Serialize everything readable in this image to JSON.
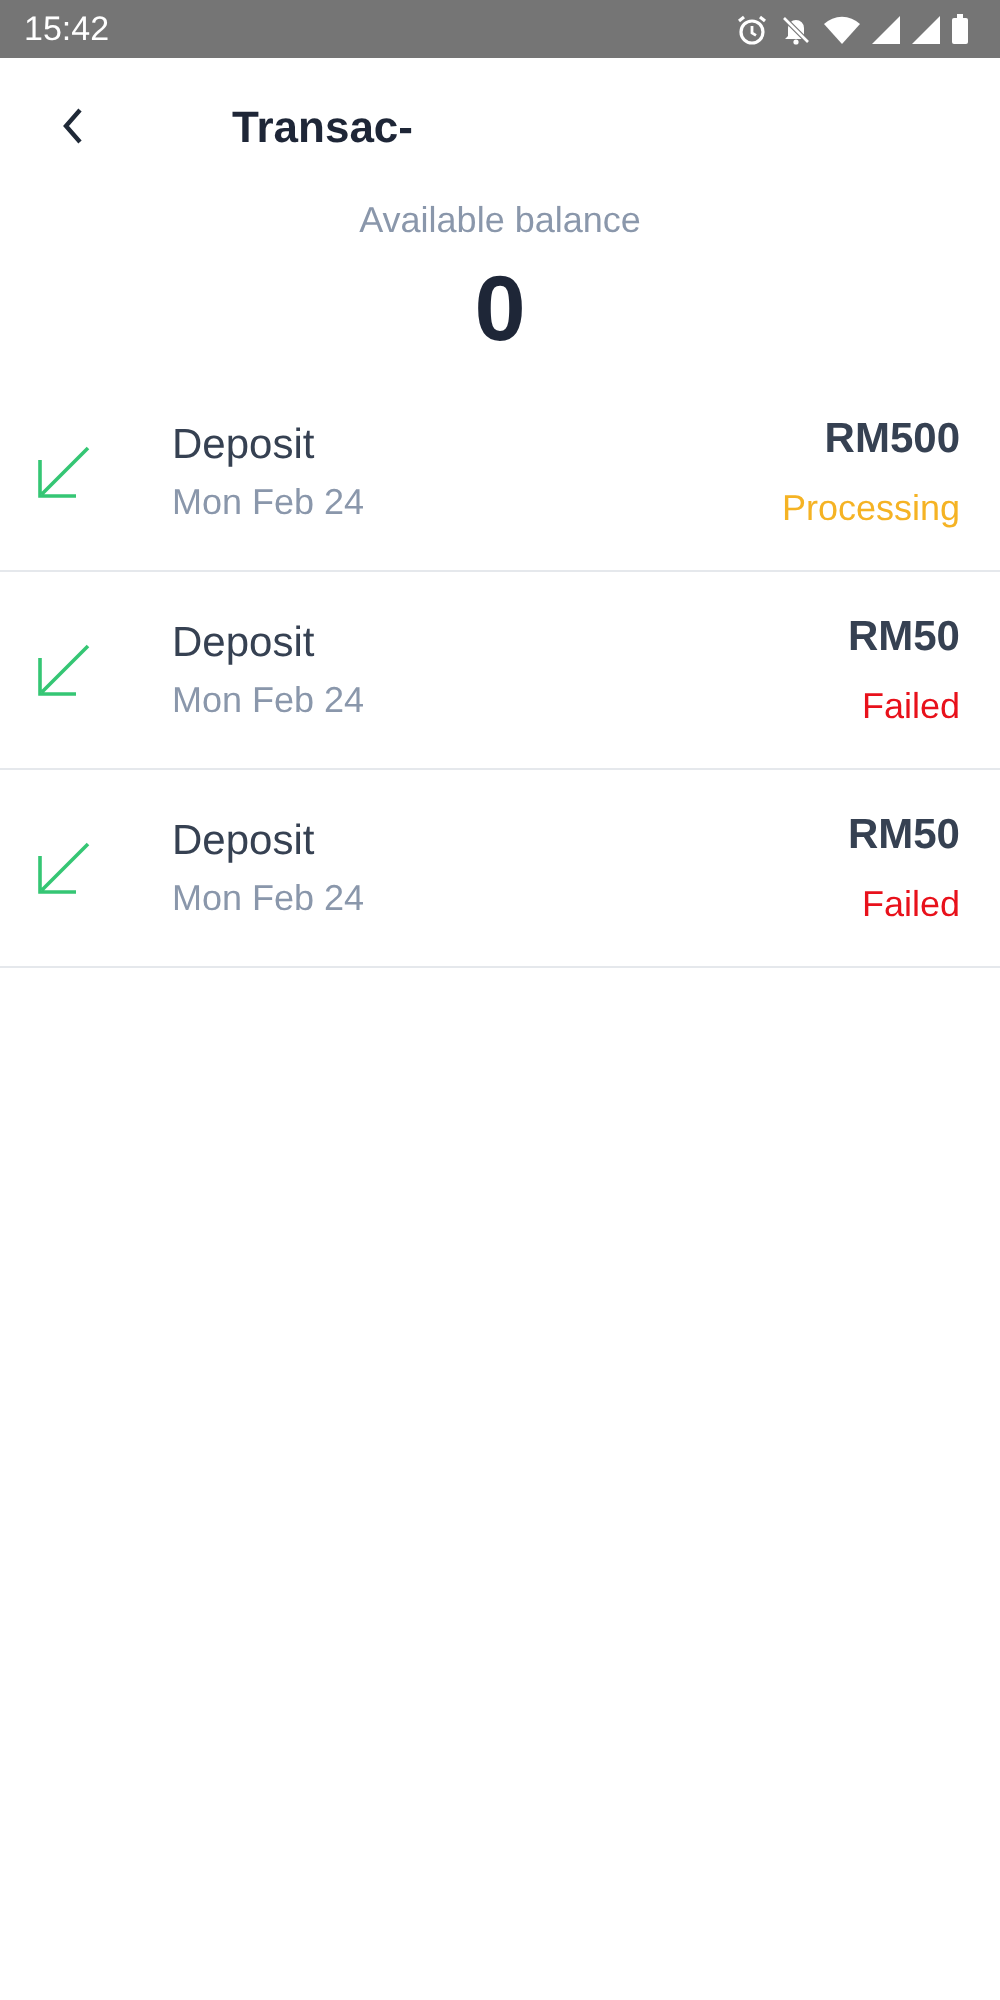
{
  "status_bar": {
    "time": "15:42"
  },
  "header": {
    "title": "Transac-"
  },
  "balance": {
    "label": "Available balance",
    "amount": "0"
  },
  "transactions": [
    {
      "title": "Deposit",
      "date": "Mon Feb 24",
      "amount": "RM500",
      "status": "Processing",
      "kind": "processing"
    },
    {
      "title": "Deposit",
      "date": "Mon Feb 24",
      "amount": "RM50",
      "status": "Failed",
      "kind": "failed"
    },
    {
      "title": "Deposit",
      "date": "Mon Feb 24",
      "amount": "RM50",
      "status": "Failed",
      "kind": "failed"
    }
  ]
}
